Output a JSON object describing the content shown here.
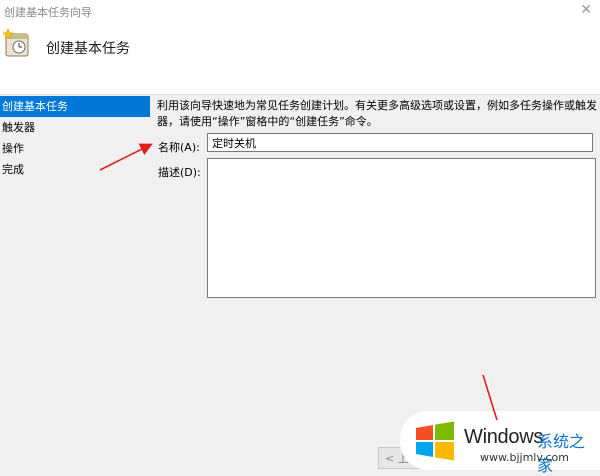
{
  "window": {
    "title": "创建基本任务向导",
    "close_glyph": "✕"
  },
  "header": {
    "heading": "创建基本任务",
    "icon": "task-wizard-clock-icon"
  },
  "sidebar": {
    "items": [
      {
        "label": "创建基本任务",
        "active": true
      },
      {
        "label": "触发器",
        "active": false
      },
      {
        "label": "操作",
        "active": false
      },
      {
        "label": "完成",
        "active": false
      }
    ]
  },
  "content": {
    "description_line1": "利用该向导快速地为常见任务创建计划。有关更多高级选项或设置，例如多任务操作或触发",
    "description_line2": "器，请使用“操作”窗格中的“创建任务”命令。",
    "name_label": "名称(A):",
    "name_value": "定时关机",
    "desc_label": "描述(D):",
    "desc_value": ""
  },
  "footer": {
    "back_label": "< 上"
  },
  "watermark": {
    "brand": "Windows",
    "brand_cn": "系统之家",
    "url": "www.bjjmlv.com"
  },
  "colors": {
    "selection": "#0078d7",
    "arrow": "#e02020",
    "watermark_blue": "#0a74c9"
  }
}
